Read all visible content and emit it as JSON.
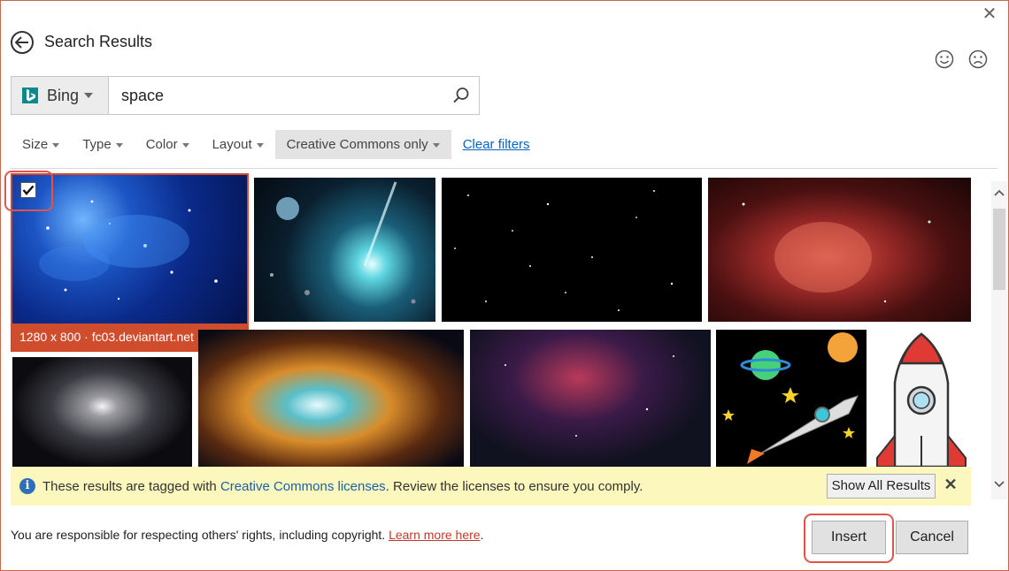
{
  "header": {
    "title": "Search Results"
  },
  "search": {
    "engine": "Bing",
    "query": "space"
  },
  "filters": {
    "items": [
      "Size",
      "Type",
      "Color",
      "Layout",
      "Creative Commons only"
    ],
    "clear_label": "Clear filters"
  },
  "selected_image": {
    "caption": "1280 x 800 · fc03.deviantart.net",
    "checked": true
  },
  "banner": {
    "text_before": "These results are tagged with ",
    "link": "Creative Commons licenses",
    "text_after": ". Review the licenses to ensure you comply.",
    "show_all_label": "Show All Results"
  },
  "footer": {
    "text": "You are responsible for respecting others' rights, including copyright. ",
    "link": "Learn more here",
    "suffix": ".",
    "insert_label": "Insert",
    "cancel_label": "Cancel"
  },
  "colors": {
    "accent": "#cf4d2c",
    "link": "#0563c1",
    "banner_bg": "#fbf7bd"
  }
}
